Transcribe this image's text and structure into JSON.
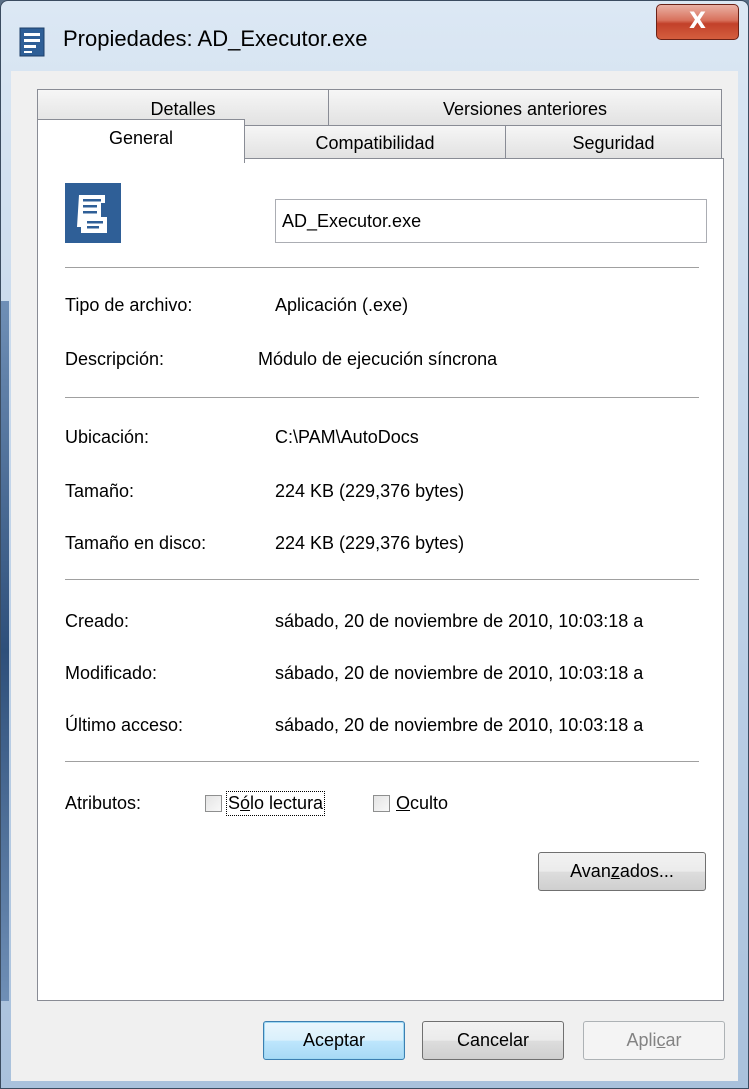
{
  "window": {
    "title": "Propiedades: AD_Executor.exe",
    "close_label": "X"
  },
  "tabs": {
    "row1": [
      "Detalles",
      "Versiones anteriores"
    ],
    "row2": [
      "General",
      "Compatibilidad",
      "Seguridad"
    ],
    "active": "General"
  },
  "general": {
    "file_name": "AD_Executor.exe",
    "type_label": "Tipo de archivo:",
    "type_value": "Aplicación (.exe)",
    "desc_label": "Descripción:",
    "desc_value": "Módulo de ejecución síncrona",
    "location_label": "Ubicación:",
    "location_value": "C:\\PAM\\AutoDocs",
    "size_label": "Tamaño:",
    "size_value": "224 KB (229,376 bytes)",
    "disk_size_label": "Tamaño en disco:",
    "disk_size_value": "224 KB (229,376 bytes)",
    "created_label": "Creado:",
    "created_value": "sábado, 20 de noviembre de 2010, 10:03:18 a",
    "modified_label": "Modificado:",
    "modified_value": "sábado, 20 de noviembre de 2010, 10:03:18 a",
    "accessed_label": "Último acceso:",
    "accessed_value": "sábado, 20 de noviembre de 2010, 10:03:18 a",
    "attributes_label": "Atributos:",
    "readonly_label_pre": "S",
    "readonly_label_key": "ó",
    "readonly_label_post": "lo lectura",
    "readonly_checked": false,
    "hidden_label_key": "O",
    "hidden_label_post": "culto",
    "hidden_checked": false,
    "advanced_pre": "Avan",
    "advanced_key": "z",
    "advanced_post": "ados..."
  },
  "buttons": {
    "ok": "Aceptar",
    "cancel": "Cancelar",
    "apply_pre": "Apli",
    "apply_key": "c",
    "apply_post": "ar"
  },
  "colors": {
    "icon_blue": "#2f5f97",
    "default_button_border": "#3c7fb1"
  }
}
